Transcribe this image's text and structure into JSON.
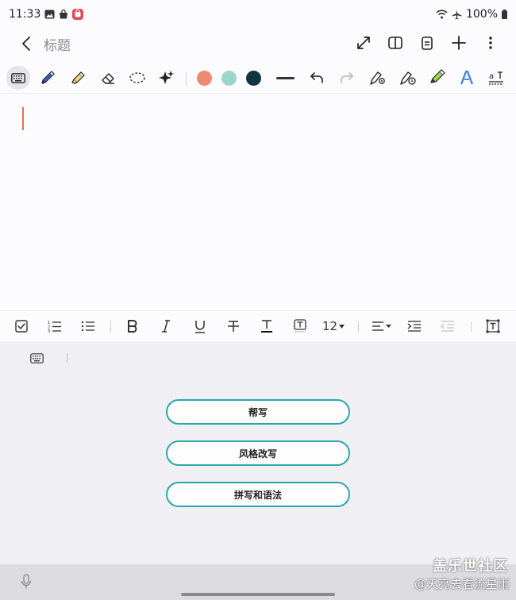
{
  "status": {
    "time": "11:33",
    "battery": "100%"
  },
  "note": {
    "title": "标题"
  },
  "colors": {
    "swatch1": "#ef8a70",
    "swatch2": "#9ad6cc",
    "swatch3": "#0f3542",
    "accent": "#2aa8a8"
  },
  "pen_toolbar": {
    "tools": [
      "keyboard-icon",
      "pen-icon",
      "highlighter-icon",
      "eraser-icon",
      "lasso-icon",
      "sparkle-icon"
    ],
    "actions": [
      "undo-icon",
      "redo-icon",
      "pen-settings-icon",
      "pen-timer-icon",
      "pen-favorite-icon",
      "text-style-icon",
      "text-recognize-icon"
    ]
  },
  "format_toolbar": {
    "font_size": "12"
  },
  "ai_panel": {
    "buttons": [
      {
        "label": "帮写"
      },
      {
        "label": "风格改写"
      },
      {
        "label": "拼写和语法"
      }
    ]
  },
  "watermark": {
    "brand": "盖乐世社区",
    "user": "@天亮去看流星雨"
  }
}
